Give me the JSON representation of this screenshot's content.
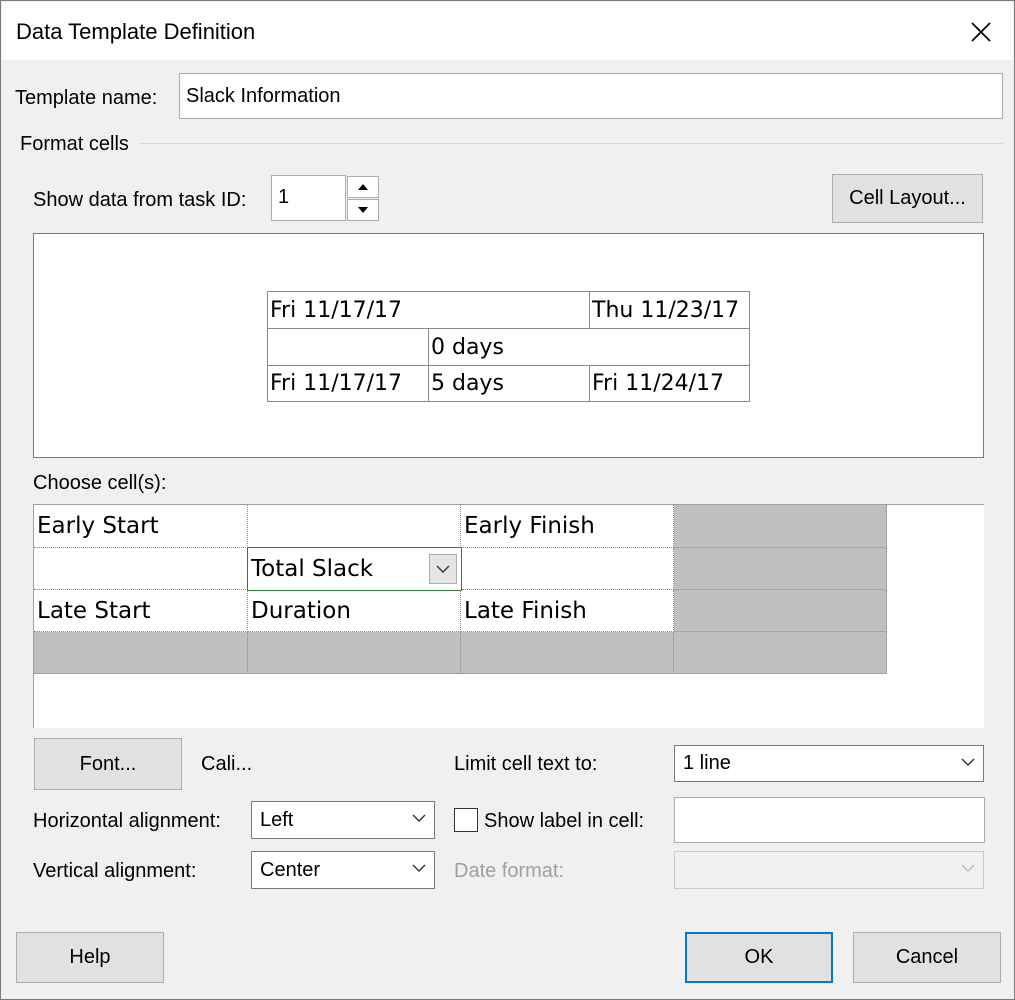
{
  "window": {
    "title": "Data Template Definition"
  },
  "template_name": {
    "label": "Template name:",
    "value": "Slack Information"
  },
  "format_cells": {
    "label": "Format cells"
  },
  "task_id": {
    "label": "Show data from task ID:",
    "value": "1"
  },
  "cell_layout_button": "Cell Layout...",
  "preview": {
    "row1": {
      "left": "Fri 11/17/17",
      "right": "Thu 11/23/17"
    },
    "row2": {
      "middle": "0 days"
    },
    "row3": {
      "left": "Fri 11/17/17",
      "middle": "5 days",
      "right": "Fri 11/24/17"
    }
  },
  "choose_cells": {
    "label": "Choose cell(s):",
    "r1c1": "Early Start",
    "r1c3": "Early Finish",
    "r2c2": "Total Slack",
    "r3c1": "Late Start",
    "r3c2": "Duration",
    "r3c3": "Late Finish"
  },
  "font": {
    "button": "Font...",
    "name": "Cali..."
  },
  "limit_cell_text": {
    "label": "Limit cell text to:",
    "value": "1 line"
  },
  "horizontal_alignment": {
    "label": "Horizontal alignment:",
    "value": "Left"
  },
  "show_label": {
    "label": "Show label in cell:",
    "checked": false,
    "value": ""
  },
  "vertical_alignment": {
    "label": "Vertical alignment:",
    "value": "Center"
  },
  "date_format": {
    "label": "Date format:",
    "value": ""
  },
  "buttons": {
    "help": "Help",
    "ok": "OK",
    "cancel": "Cancel"
  }
}
